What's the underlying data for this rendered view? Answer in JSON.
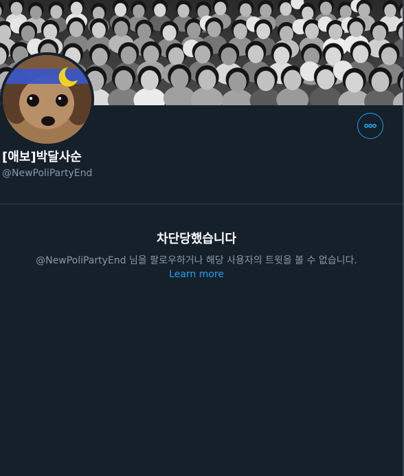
{
  "profile": {
    "display_name": "[애보]박달사순",
    "handle": "@NewPoliPartyEnd"
  },
  "more_button": {
    "icon": "more-horizontal-icon"
  },
  "blocked": {
    "title": "차단당했습니다",
    "description": "@NewPoliPartyEnd 님을 팔로우하거나 해당 사용자의 트윗을 볼 수 없습니다.",
    "learn_more": "Learn more"
  },
  "colors": {
    "background": "#15202b",
    "accent": "#1da1f2",
    "secondary_text": "#8899a6",
    "divider": "#38444d"
  }
}
